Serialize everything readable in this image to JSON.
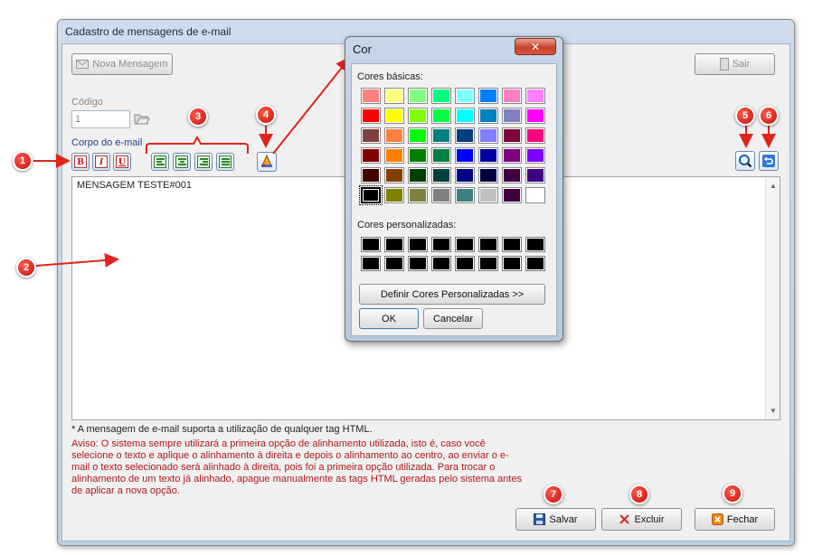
{
  "window": {
    "title": "Cadastro de mensagens de e-mail",
    "new_message_label": "Nova Mensagem",
    "exit_label": "Sair"
  },
  "form": {
    "code_label": "Código",
    "code_value": "1",
    "body_label": "Corpo do e-mail",
    "bold_label": "B",
    "italic_label": "I",
    "underline_label": "U",
    "message_text": "MENSAGEM TESTE#001"
  },
  "notes": {
    "html_note": "* A mensagem de e-mail suporta a utilização de qualquer tag HTML.",
    "warning": "Aviso: O sistema sempre utilizará a primeira opção de alinhamento utilizada, isto é, caso você selecione o texto e aplique o alinhamento à direita e depois o alinhamento ao centro, ao enviar o e-mail o texto selecionado será alinhado à direita, pois foi a primeira opção utilizada. Para trocar o alinhamento de um texto já alinhado, apague manualmente as tags HTML geradas pelo sistema antes de aplicar a nova opção."
  },
  "footer": {
    "save_label": "Salvar",
    "delete_label": "Excluir",
    "close_label": "Fechar"
  },
  "markers": [
    "1",
    "2",
    "3",
    "4",
    "5",
    "6",
    "7",
    "8",
    "9"
  ],
  "color_dialog": {
    "title": "Cor",
    "basic_label": "Cores básicas:",
    "custom_label": "Cores personalizadas:",
    "define_custom_label": "Definir Cores Personalizadas >>",
    "ok_label": "OK",
    "cancel_label": "Cancelar",
    "basic_colors": [
      "#ff8080",
      "#ffff80",
      "#80ff80",
      "#00ff80",
      "#80ffff",
      "#0080ff",
      "#ff80c0",
      "#ff80ff",
      "#ff0000",
      "#ffff00",
      "#80ff00",
      "#00ff40",
      "#00ffff",
      "#0080c0",
      "#8080c0",
      "#ff00ff",
      "#804040",
      "#ff8040",
      "#00ff00",
      "#008080",
      "#004080",
      "#8080ff",
      "#800040",
      "#ff0080",
      "#800000",
      "#ff8000",
      "#008000",
      "#008040",
      "#0000ff",
      "#0000a0",
      "#800080",
      "#8000ff",
      "#400000",
      "#804000",
      "#004000",
      "#004040",
      "#000080",
      "#000040",
      "#400040",
      "#400080",
      "#000000",
      "#808000",
      "#808040",
      "#808080",
      "#408080",
      "#c0c0c0",
      "#400040",
      "#ffffff"
    ],
    "selected_index": 40,
    "custom_colors": [
      "#000000",
      "#000000",
      "#000000",
      "#000000",
      "#000000",
      "#000000",
      "#000000",
      "#000000",
      "#000000",
      "#000000",
      "#000000",
      "#000000",
      "#000000",
      "#000000",
      "#000000",
      "#000000"
    ]
  },
  "colors": {
    "marker_red": "#d21a12",
    "warning_text": "#b01818",
    "window_frame": "#c4d4e8"
  }
}
